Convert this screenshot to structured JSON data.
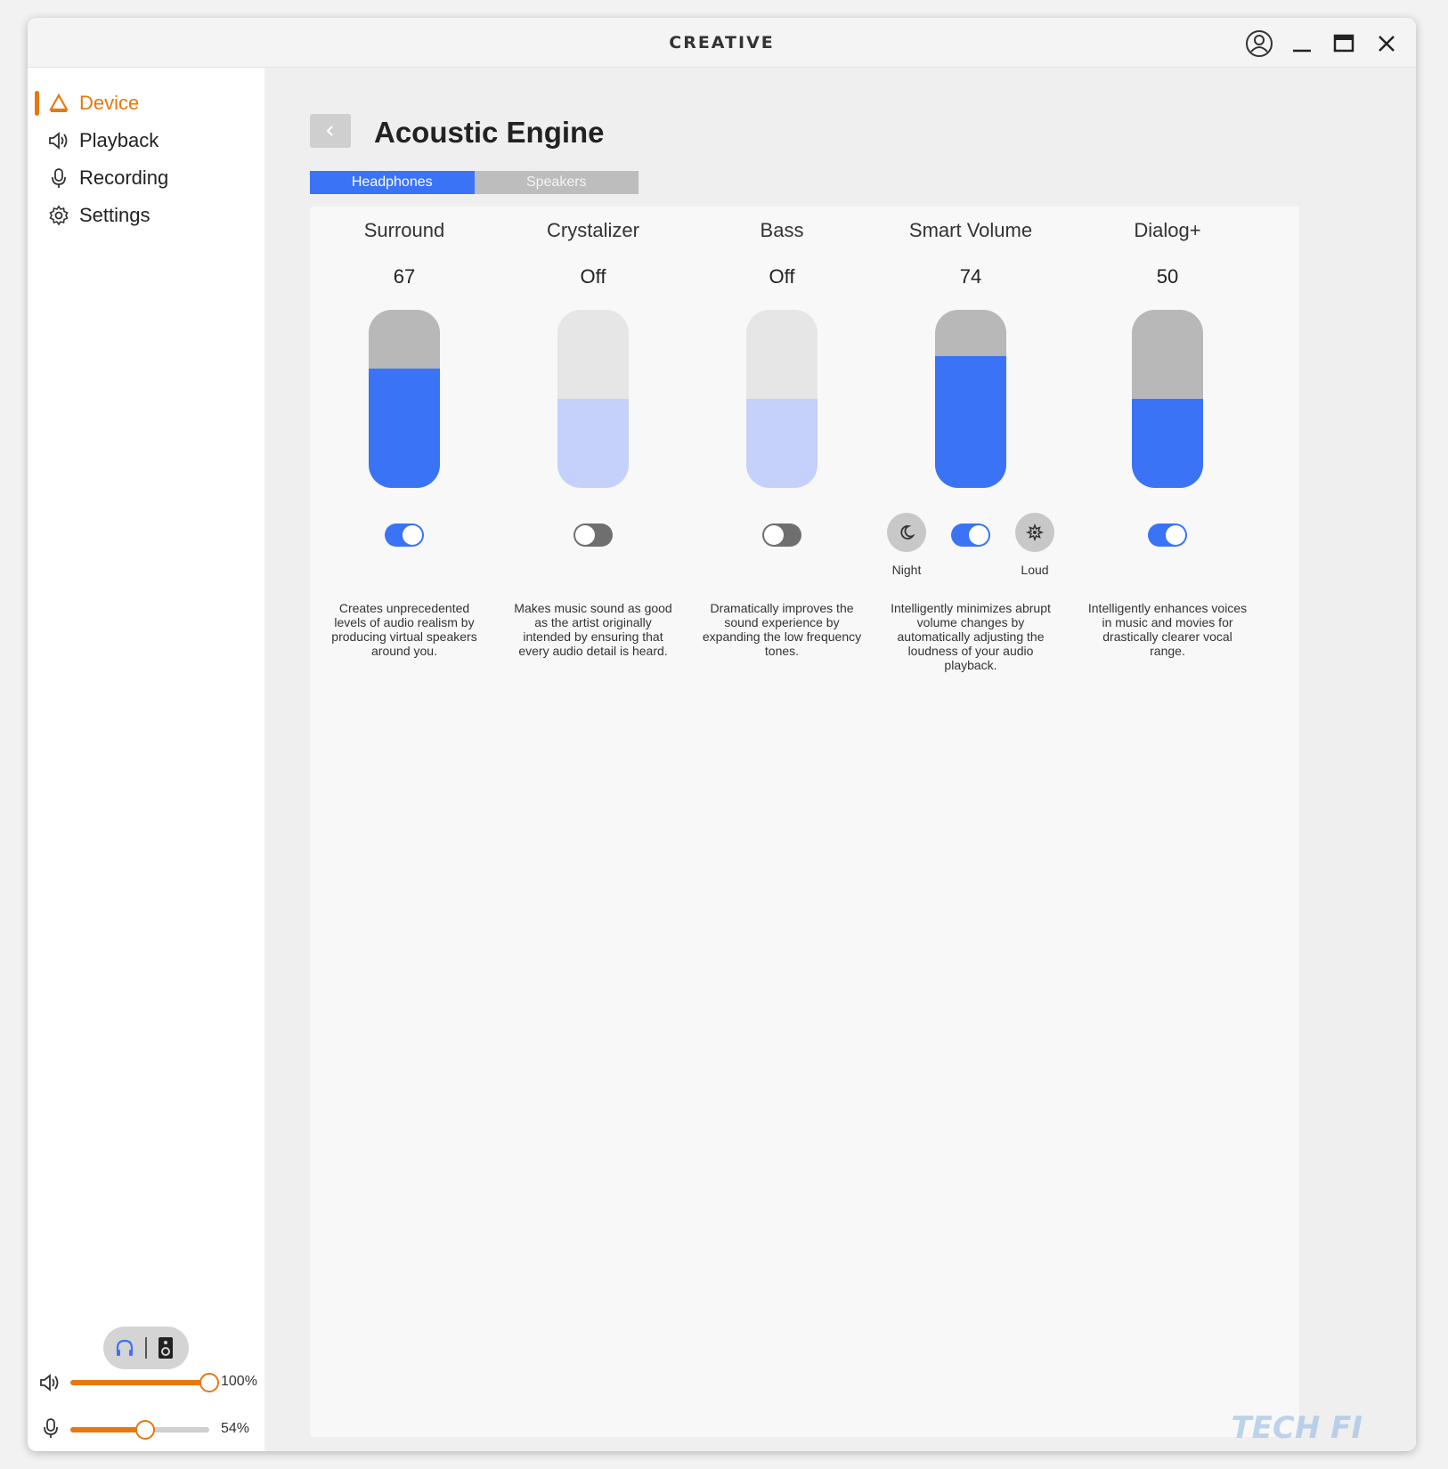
{
  "app": {
    "brand": "CREATIVE"
  },
  "sidebar": {
    "items": [
      {
        "label": "Device",
        "icon": "device-logo-icon",
        "active": true
      },
      {
        "label": "Playback",
        "icon": "speaker-icon",
        "active": false
      },
      {
        "label": "Recording",
        "icon": "microphone-icon",
        "active": false
      },
      {
        "label": "Settings",
        "icon": "gear-icon",
        "active": false
      }
    ],
    "output_switch": {
      "selected": "headphones"
    },
    "playback_volume": {
      "value": 100,
      "label": "100%"
    },
    "recording_volume": {
      "value": 54,
      "label": "54%"
    }
  },
  "header": {
    "title": "Acoustic Engine"
  },
  "tabs": [
    {
      "label": "Headphones",
      "active": true
    },
    {
      "label": "Speakers",
      "active": false
    }
  ],
  "effects": [
    {
      "name": "Surround",
      "value": "67",
      "level": 67,
      "enabled": true,
      "description": "Creates unprecedented levels of audio realism by producing virtual speakers around you."
    },
    {
      "name": "Crystalizer",
      "value": "Off",
      "level": 50,
      "enabled": false,
      "description": "Makes music sound as good as the artist originally intended by ensuring that every audio detail is heard."
    },
    {
      "name": "Bass",
      "value": "Off",
      "level": 50,
      "enabled": false,
      "description": "Dramatically improves the sound experience by expanding the low frequency tones."
    },
    {
      "name": "Smart Volume",
      "value": "74",
      "level": 74,
      "enabled": true,
      "description": "Intelligently minimizes abrupt volume changes by automatically adjusting the loudness of your audio playback.",
      "modes": {
        "night": "Night",
        "loud": "Loud"
      }
    },
    {
      "name": "Dialog+",
      "value": "50",
      "level": 50,
      "enabled": true,
      "description": "Intelligently enhances voices in music and movies for drastically clearer vocal range."
    }
  ],
  "colors": {
    "accent": "#3b73f6",
    "accent_light": "#c5d1fb",
    "brand_orange": "#e8780e",
    "track_on": "#b8b8b8",
    "track_off": "#e6e6e6",
    "switch_off": "#6f6f6f"
  },
  "watermark": "TECH FI"
}
